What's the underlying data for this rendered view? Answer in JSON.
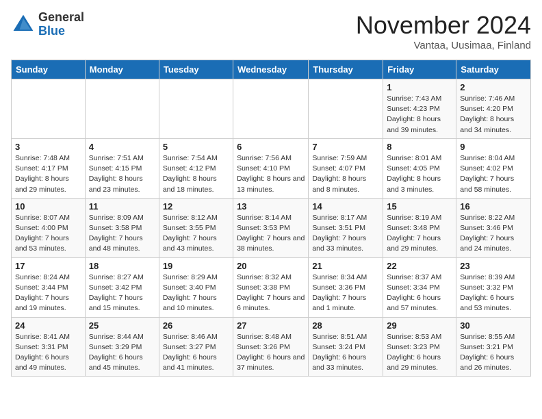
{
  "header": {
    "logo_general": "General",
    "logo_blue": "Blue",
    "month_title": "November 2024",
    "location": "Vantaa, Uusimaa, Finland"
  },
  "days_of_week": [
    "Sunday",
    "Monday",
    "Tuesday",
    "Wednesday",
    "Thursday",
    "Friday",
    "Saturday"
  ],
  "weeks": [
    [
      {
        "day": "",
        "info": ""
      },
      {
        "day": "",
        "info": ""
      },
      {
        "day": "",
        "info": ""
      },
      {
        "day": "",
        "info": ""
      },
      {
        "day": "",
        "info": ""
      },
      {
        "day": "1",
        "info": "Sunrise: 7:43 AM\nSunset: 4:23 PM\nDaylight: 8 hours and 39 minutes."
      },
      {
        "day": "2",
        "info": "Sunrise: 7:46 AM\nSunset: 4:20 PM\nDaylight: 8 hours and 34 minutes."
      }
    ],
    [
      {
        "day": "3",
        "info": "Sunrise: 7:48 AM\nSunset: 4:17 PM\nDaylight: 8 hours and 29 minutes."
      },
      {
        "day": "4",
        "info": "Sunrise: 7:51 AM\nSunset: 4:15 PM\nDaylight: 8 hours and 23 minutes."
      },
      {
        "day": "5",
        "info": "Sunrise: 7:54 AM\nSunset: 4:12 PM\nDaylight: 8 hours and 18 minutes."
      },
      {
        "day": "6",
        "info": "Sunrise: 7:56 AM\nSunset: 4:10 PM\nDaylight: 8 hours and 13 minutes."
      },
      {
        "day": "7",
        "info": "Sunrise: 7:59 AM\nSunset: 4:07 PM\nDaylight: 8 hours and 8 minutes."
      },
      {
        "day": "8",
        "info": "Sunrise: 8:01 AM\nSunset: 4:05 PM\nDaylight: 8 hours and 3 minutes."
      },
      {
        "day": "9",
        "info": "Sunrise: 8:04 AM\nSunset: 4:02 PM\nDaylight: 7 hours and 58 minutes."
      }
    ],
    [
      {
        "day": "10",
        "info": "Sunrise: 8:07 AM\nSunset: 4:00 PM\nDaylight: 7 hours and 53 minutes."
      },
      {
        "day": "11",
        "info": "Sunrise: 8:09 AM\nSunset: 3:58 PM\nDaylight: 7 hours and 48 minutes."
      },
      {
        "day": "12",
        "info": "Sunrise: 8:12 AM\nSunset: 3:55 PM\nDaylight: 7 hours and 43 minutes."
      },
      {
        "day": "13",
        "info": "Sunrise: 8:14 AM\nSunset: 3:53 PM\nDaylight: 7 hours and 38 minutes."
      },
      {
        "day": "14",
        "info": "Sunrise: 8:17 AM\nSunset: 3:51 PM\nDaylight: 7 hours and 33 minutes."
      },
      {
        "day": "15",
        "info": "Sunrise: 8:19 AM\nSunset: 3:48 PM\nDaylight: 7 hours and 29 minutes."
      },
      {
        "day": "16",
        "info": "Sunrise: 8:22 AM\nSunset: 3:46 PM\nDaylight: 7 hours and 24 minutes."
      }
    ],
    [
      {
        "day": "17",
        "info": "Sunrise: 8:24 AM\nSunset: 3:44 PM\nDaylight: 7 hours and 19 minutes."
      },
      {
        "day": "18",
        "info": "Sunrise: 8:27 AM\nSunset: 3:42 PM\nDaylight: 7 hours and 15 minutes."
      },
      {
        "day": "19",
        "info": "Sunrise: 8:29 AM\nSunset: 3:40 PM\nDaylight: 7 hours and 10 minutes."
      },
      {
        "day": "20",
        "info": "Sunrise: 8:32 AM\nSunset: 3:38 PM\nDaylight: 7 hours and 6 minutes."
      },
      {
        "day": "21",
        "info": "Sunrise: 8:34 AM\nSunset: 3:36 PM\nDaylight: 7 hours and 1 minute."
      },
      {
        "day": "22",
        "info": "Sunrise: 8:37 AM\nSunset: 3:34 PM\nDaylight: 6 hours and 57 minutes."
      },
      {
        "day": "23",
        "info": "Sunrise: 8:39 AM\nSunset: 3:32 PM\nDaylight: 6 hours and 53 minutes."
      }
    ],
    [
      {
        "day": "24",
        "info": "Sunrise: 8:41 AM\nSunset: 3:31 PM\nDaylight: 6 hours and 49 minutes."
      },
      {
        "day": "25",
        "info": "Sunrise: 8:44 AM\nSunset: 3:29 PM\nDaylight: 6 hours and 45 minutes."
      },
      {
        "day": "26",
        "info": "Sunrise: 8:46 AM\nSunset: 3:27 PM\nDaylight: 6 hours and 41 minutes."
      },
      {
        "day": "27",
        "info": "Sunrise: 8:48 AM\nSunset: 3:26 PM\nDaylight: 6 hours and 37 minutes."
      },
      {
        "day": "28",
        "info": "Sunrise: 8:51 AM\nSunset: 3:24 PM\nDaylight: 6 hours and 33 minutes."
      },
      {
        "day": "29",
        "info": "Sunrise: 8:53 AM\nSunset: 3:23 PM\nDaylight: 6 hours and 29 minutes."
      },
      {
        "day": "30",
        "info": "Sunrise: 8:55 AM\nSunset: 3:21 PM\nDaylight: 6 hours and 26 minutes."
      }
    ]
  ]
}
